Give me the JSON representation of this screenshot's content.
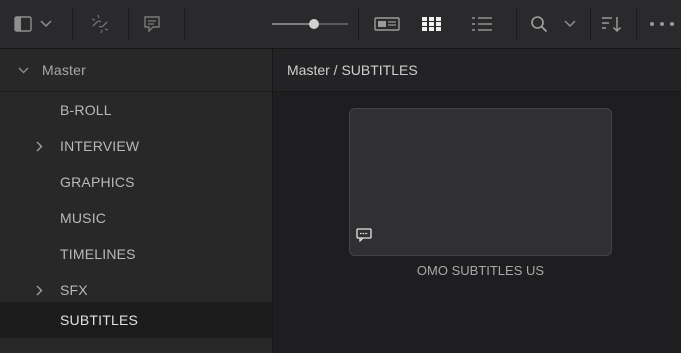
{
  "toolbar": {
    "icons": [
      "panel-toggle-icon",
      "chevron-down-icon",
      "unlink-icon",
      "subtitle-icon",
      "thumbnail-size-slider",
      "metadata-view-icon",
      "grid-view-icon",
      "list-view-icon",
      "search-icon",
      "chevron-down-icon",
      "sort-icon",
      "more-icon"
    ],
    "thumbnail_slider_value": 0.55
  },
  "sidebar": {
    "header": "Master",
    "items": [
      {
        "label": "B-ROLL",
        "expandable": false,
        "selected": false
      },
      {
        "label": "INTERVIEW",
        "expandable": true,
        "selected": false
      },
      {
        "label": "GRAPHICS",
        "expandable": false,
        "selected": false
      },
      {
        "label": "MUSIC",
        "expandable": false,
        "selected": false
      },
      {
        "label": "TIMELINES",
        "expandable": false,
        "selected": false
      },
      {
        "label": "SFX",
        "expandable": true,
        "selected": false
      },
      {
        "label": "SUBTITLES",
        "expandable": false,
        "selected": true
      }
    ]
  },
  "main": {
    "breadcrumb": "Master / SUBTITLES",
    "clips": [
      {
        "name": "OMO SUBTITLES US",
        "icon": "subtitle-icon"
      }
    ]
  }
}
